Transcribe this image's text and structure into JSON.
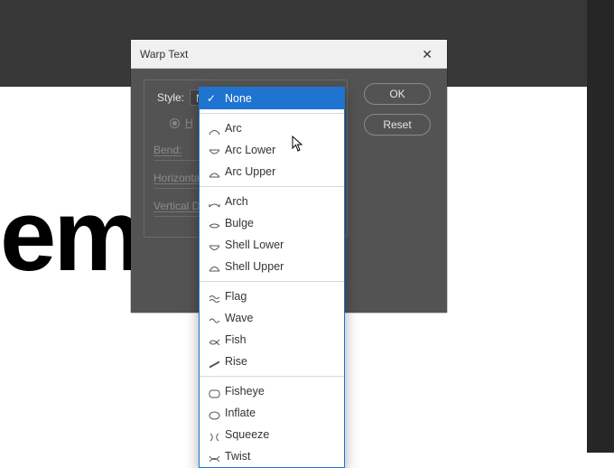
{
  "canvas": {
    "big_text": "em ipsum"
  },
  "dialog": {
    "title": "Warp Text",
    "style_label": "Style:",
    "style_selected": "None",
    "orientation": {
      "h": "H"
    },
    "sliders": {
      "bend": {
        "label": "Bend:",
        "unit": "%"
      },
      "hdist": {
        "label": "Horizontal",
        "unit": "%"
      },
      "vdist": {
        "label": "Vertical D",
        "unit": "%"
      }
    },
    "buttons": {
      "ok": "OK",
      "reset": "Reset"
    }
  },
  "dropdown": {
    "items": [
      {
        "label": "None",
        "selected": true
      },
      "sep",
      {
        "label": "Arc",
        "icon": "arc"
      },
      {
        "label": "Arc Lower",
        "icon": "arclower"
      },
      {
        "label": "Arc Upper",
        "icon": "arcupper"
      },
      "sep",
      {
        "label": "Arch",
        "icon": "arch"
      },
      {
        "label": "Bulge",
        "icon": "bulge"
      },
      {
        "label": "Shell Lower",
        "icon": "shelllower"
      },
      {
        "label": "Shell Upper",
        "icon": "shellupper"
      },
      "sep",
      {
        "label": "Flag",
        "icon": "flag"
      },
      {
        "label": "Wave",
        "icon": "wave"
      },
      {
        "label": "Fish",
        "icon": "fish"
      },
      {
        "label": "Rise",
        "icon": "rise"
      },
      "sep",
      {
        "label": "Fisheye",
        "icon": "fisheye"
      },
      {
        "label": "Inflate",
        "icon": "inflate"
      },
      {
        "label": "Squeeze",
        "icon": "squeeze"
      },
      {
        "label": "Twist",
        "icon": "twist"
      }
    ]
  }
}
